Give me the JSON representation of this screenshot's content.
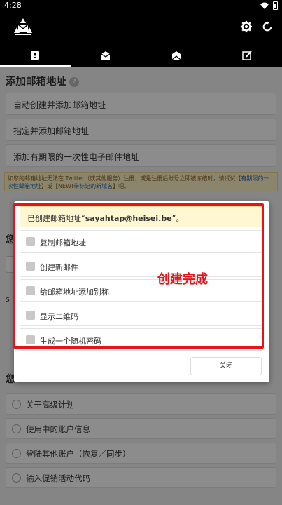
{
  "status_bar": {
    "time": "4:28"
  },
  "tabs": [
    {
      "name": "tab-addresses",
      "active": true
    },
    {
      "name": "tab-inbox",
      "active": false
    },
    {
      "name": "tab-outbox",
      "active": false
    },
    {
      "name": "tab-compose",
      "active": false
    }
  ],
  "add_section": {
    "title": "添加邮箱地址",
    "items": [
      "自动创建并添加邮箱地址",
      "指定并添加邮箱地址",
      "添加有期限的一次性电子邮件地址"
    ]
  },
  "warning": {
    "part1": "如您的邮箱地址无法在 Twitter（或其他服务）注册，或是注册后账号立即被冻结时，请试试【",
    "link1": "有期限的一次性邮箱地址",
    "part2": "】或【NEW!",
    "link2": "带标记的新域名",
    "part3": "】吧。"
  },
  "background": {
    "frag_title_1": "您",
    "frag_title_2": "您",
    "frag_mid": "s",
    "items": [
      "关于高级计划",
      "使用中的账户信息",
      "登陆其他账户（恢复／同步）",
      "输入促销活动代码"
    ]
  },
  "dialog": {
    "notice_prefix": "已创建邮箱地址“",
    "notice_email": "sayahtap@heisei.be",
    "notice_suffix": "”。",
    "options": [
      "复制邮箱地址",
      "创建新邮件",
      "给邮箱地址添加别称",
      "显示二维码",
      "生成一个随机密码"
    ],
    "close_label": "关闭"
  },
  "annotation": "创建完成",
  "colors": {
    "accent_red": "#e5141b",
    "notice_bg": "#fff6d2",
    "appbar": "#000000"
  }
}
